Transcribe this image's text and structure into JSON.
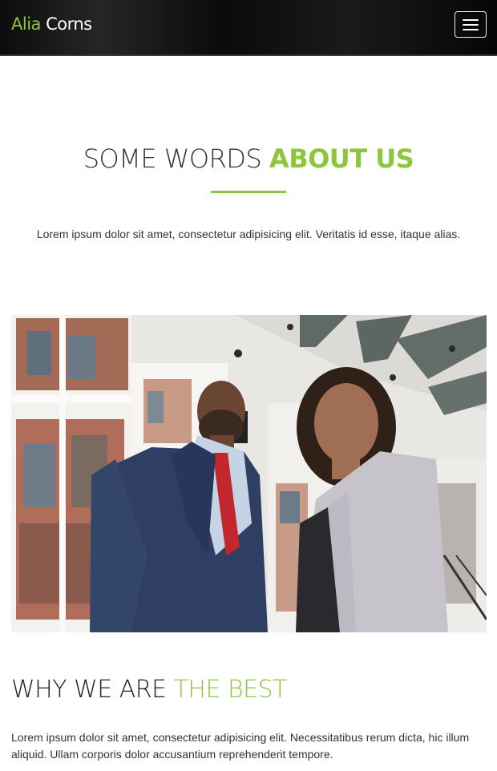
{
  "brand": {
    "first": "Alia",
    "second": "Corns"
  },
  "nav": {
    "toggle_icon": "hamburger-icon"
  },
  "about": {
    "title_plain": "SOME WORDS ",
    "title_accent": "ABOUT US",
    "text": "Lorem ipsum dolor sit amet, consectetur adipisicing elit. Veritatis id esse, itaque alias."
  },
  "photo": {
    "alt": ""
  },
  "best": {
    "title_plain": "WHY WE ARE ",
    "title_accent": "THE BEST",
    "text": "Lorem ipsum dolor sit amet, consectetur adipisicing elit. Necessitatibus rerum dicta, hic illum aliquid. Ullam corporis dolor accusantium reprehenderit tempore."
  },
  "colors": {
    "accent": "#8cc63f",
    "navbar": "#111111",
    "text": "#333333"
  }
}
